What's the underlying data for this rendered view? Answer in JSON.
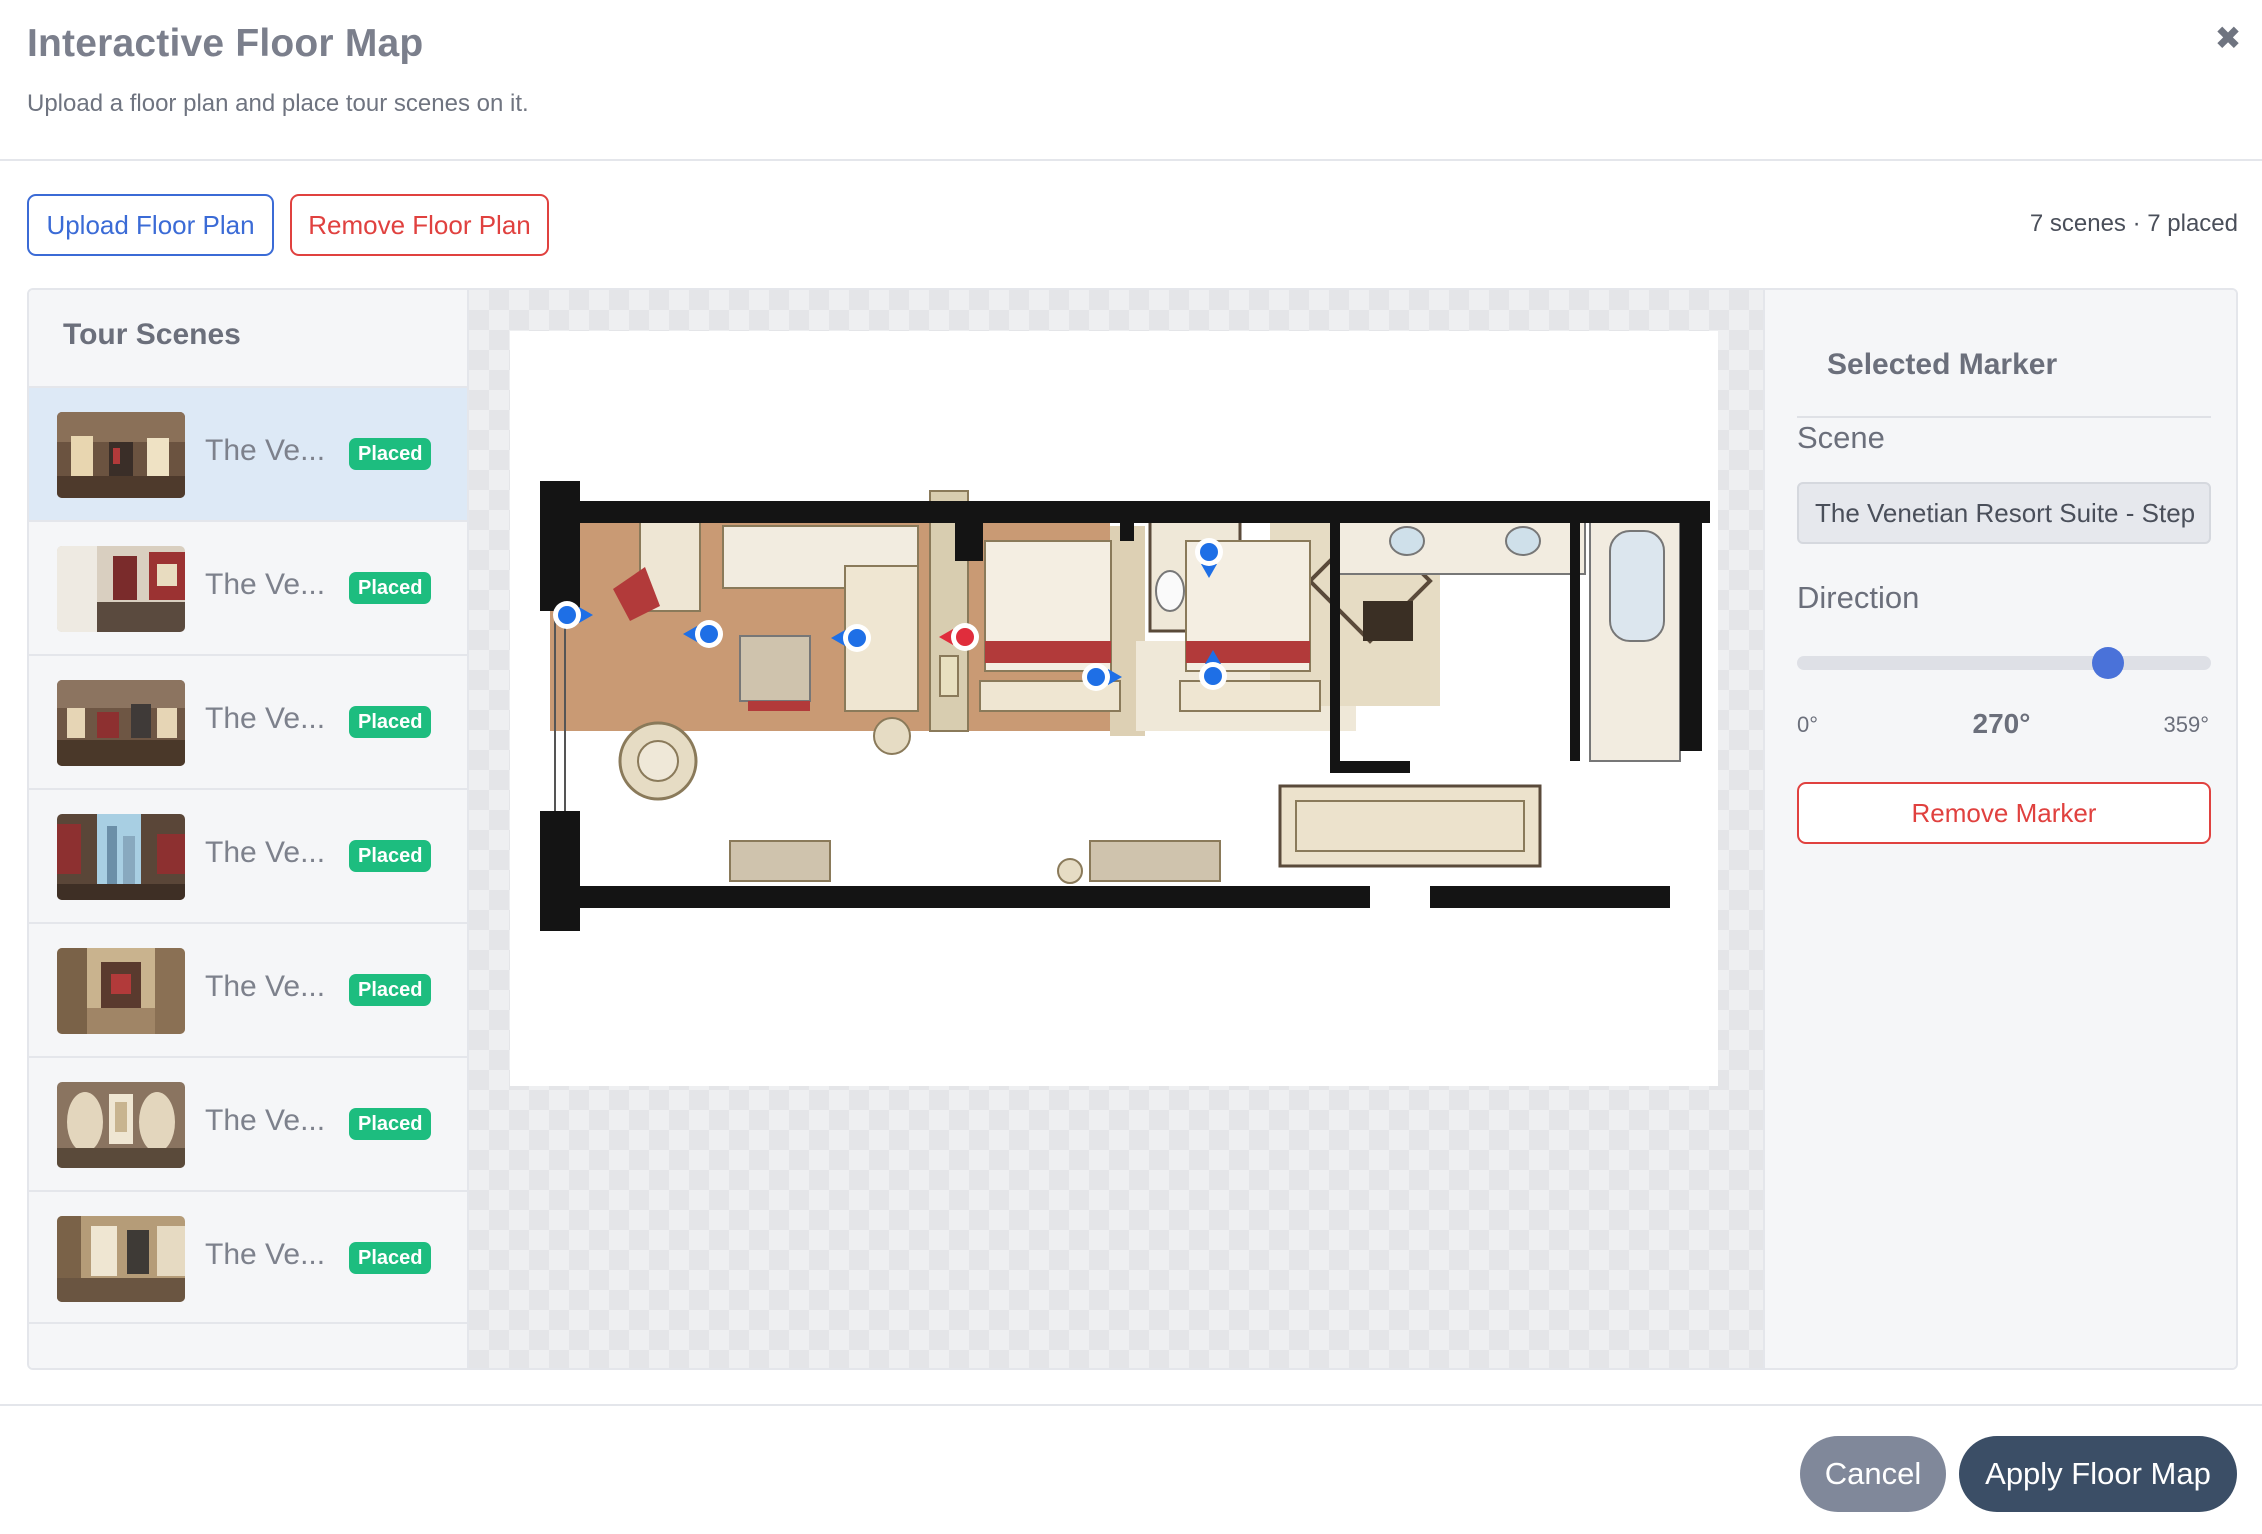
{
  "dialog": {
    "title": "Interactive Floor Map",
    "subtitle": "Upload a floor plan and place tour scenes on it.",
    "close_icon": "close-icon"
  },
  "toolbar": {
    "upload_label": "Upload Floor Plan",
    "remove_label": "Remove Floor Plan",
    "scene_count": "7 scenes · 7 placed"
  },
  "sidebar": {
    "title": "Tour Scenes",
    "scenes": [
      {
        "name": "The Ve...",
        "badge": "Placed",
        "selected": true
      },
      {
        "name": "The Ve...",
        "badge": "Placed"
      },
      {
        "name": "The Ve...",
        "badge": "Placed"
      },
      {
        "name": "The Ve...",
        "badge": "Placed"
      },
      {
        "name": "The Ve...",
        "badge": "Placed"
      },
      {
        "name": "The Ve...",
        "badge": "Placed"
      },
      {
        "name": "The Ve...",
        "badge": "Placed"
      }
    ]
  },
  "floorplan": {
    "markers": [
      {
        "direction": 90,
        "selected": false
      },
      {
        "direction": 270,
        "selected": false
      },
      {
        "direction": 270,
        "selected": false
      },
      {
        "direction": 270,
        "selected": true
      },
      {
        "direction": 90,
        "selected": false
      },
      {
        "direction": 180,
        "selected": false
      },
      {
        "direction": 0,
        "selected": false
      }
    ],
    "marker_color": "#1e6fe6",
    "selected_marker_color": "#e02d3c"
  },
  "selected_marker": {
    "title": "Selected Marker",
    "scene_label": "Scene",
    "scene_value": "The Venetian Resort Suite - Step",
    "direction_label": "Direction",
    "direction_min": "0°",
    "direction_value": "270°",
    "direction_max": "359°",
    "direction_degrees": 270,
    "remove_label": "Remove Marker"
  },
  "footer": {
    "cancel_label": "Cancel",
    "apply_label": "Apply Floor Map"
  },
  "colors": {
    "primary": "#3b6bd6",
    "danger": "#e0413f",
    "success": "#1dbd7f",
    "apply": "#3b4e66"
  }
}
